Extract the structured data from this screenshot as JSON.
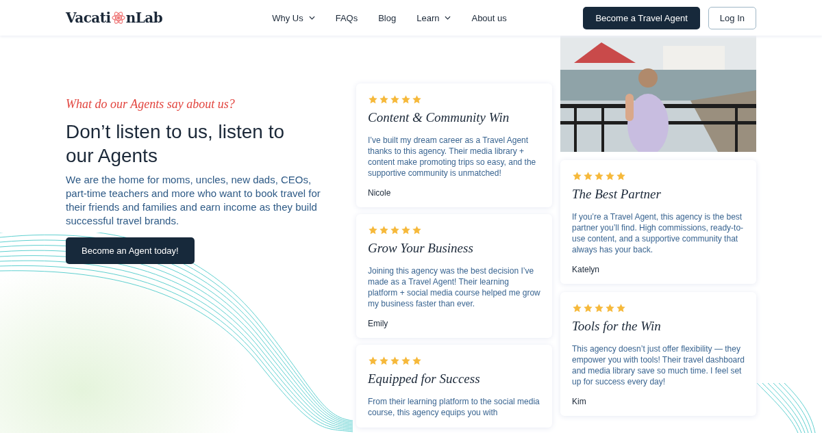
{
  "header": {
    "logo_start": "Vacati",
    "logo_end": "nLab",
    "nav": [
      {
        "label": "Why Us",
        "dropdown": true
      },
      {
        "label": "FAQs",
        "dropdown": false
      },
      {
        "label": "Blog",
        "dropdown": false
      },
      {
        "label": "Learn",
        "dropdown": true
      },
      {
        "label": "About us",
        "dropdown": false
      }
    ],
    "primary_button": "Become a Travel Agent",
    "secondary_button": "Log In"
  },
  "hero": {
    "eyebrow": "What do our Agents say about us?",
    "heading": "Don’t listen to us, listen to our Agents",
    "description": "We are the home for moms, uncles, new dads, CEOs, part-time teachers and more who want to book travel for their friends and families and earn income as they build successful travel brands.",
    "cta": "Become an Agent today!"
  },
  "testimonial_columns": [
    {
      "items": [
        {
          "kind": "card",
          "stars": 5,
          "title": "Content & Community Win",
          "quote": "I’ve built my dream career as a Travel Agent thanks to this agency. Their media library + content make promoting trips so easy, and the supportive community is unmatched!",
          "author": "Nicole"
        },
        {
          "kind": "card",
          "stars": 5,
          "title": "Grow Your Business",
          "quote": "Joining this agency was the best decision I’ve made as a Travel Agent! Their learning platform + social media course helped me grow my business faster than ever.",
          "author": "Emily"
        },
        {
          "kind": "card",
          "stars": 5,
          "title": "Equipped for Success",
          "quote": "From their learning platform to the social media course, this agency equips you with"
        }
      ]
    },
    {
      "items": [
        {
          "kind": "picture"
        },
        {
          "kind": "card",
          "stars": 5,
          "title": "The Best Partner",
          "quote": "If you’re a Travel Agent, this agency is the best partner you’ll find. High commissions, ready-to-use content, and a supportive community that always has your back.",
          "author": "Katelyn"
        },
        {
          "kind": "card",
          "stars": 5,
          "title": "Tools for the Win",
          "quote": "This agency doesn’t just offer flexibility — they empower you with tools! Their travel dashboard and media library save so much time. I feel set up for success every day!",
          "author": "Kim"
        }
      ]
    }
  ]
}
